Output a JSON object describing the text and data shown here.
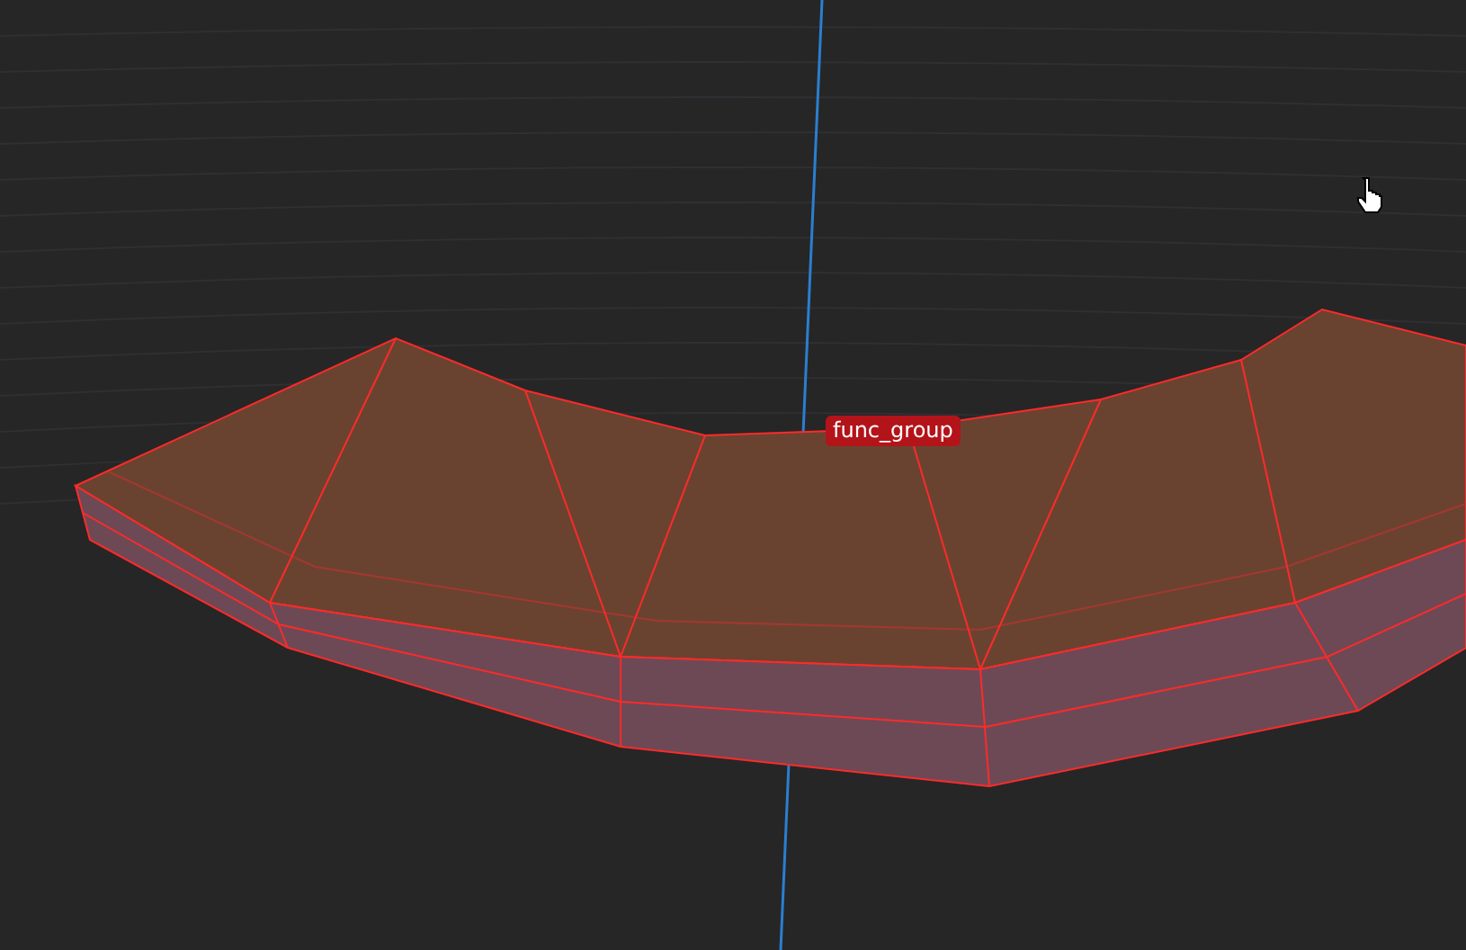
{
  "viewport": {
    "selection_label": "func_group"
  }
}
